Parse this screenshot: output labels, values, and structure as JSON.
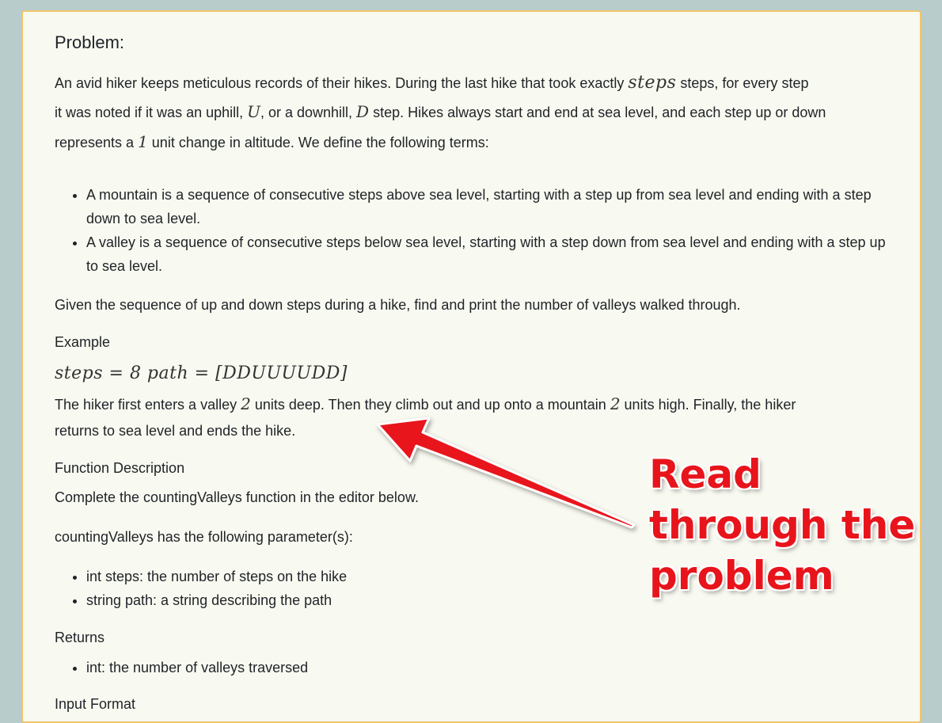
{
  "problem": {
    "title": "Problem:",
    "intro": {
      "a": "An avid hiker keeps meticulous records of their hikes. During the last hike that took exactly ",
      "m1": "steps",
      "b": " steps, for every step",
      "c": "it was noted if it was an uphill, ",
      "m2": "U",
      "d": ", or a downhill, ",
      "m3": "D",
      "e": " step. Hikes always start and end at sea level, and each step up or down",
      "f": "represents a ",
      "m4": "1",
      "g": " unit change in altitude. We define the following terms:"
    },
    "terms": [
      "A mountain is a sequence of consecutive steps above sea level, starting with a step up from sea level and ending with a step down to sea level.",
      "A valley is a sequence of consecutive steps below sea level, starting with a step down from sea level and ending with a step up to sea level."
    ],
    "task": "Given the sequence of up and down steps during a hike, find and print the number of valleys walked through.",
    "example_heading": "Example",
    "example_math": "steps = 8 path = [DDUUUUDD]",
    "example_text": {
      "a": "The hiker first enters a valley ",
      "m1": "2",
      "b": " units deep. Then they climb out and up onto a mountain ",
      "m2": "2",
      "c": " units high. Finally, the hiker",
      "d": "returns to sea level and ends the hike."
    },
    "function_heading": "Function Description",
    "function_text": "Complete the countingValleys function in the editor below.",
    "params_text": "countingValleys has the following parameter(s):",
    "params": [
      "int steps: the number of steps on the hike",
      "string path: a string describing the path"
    ],
    "returns_heading": "Returns",
    "returns": [
      "int: the number of valleys traversed"
    ],
    "input_heading": "Input Format"
  },
  "annotation": {
    "text": "Read\nthrough the\nproblem",
    "color": "#e8141b"
  }
}
